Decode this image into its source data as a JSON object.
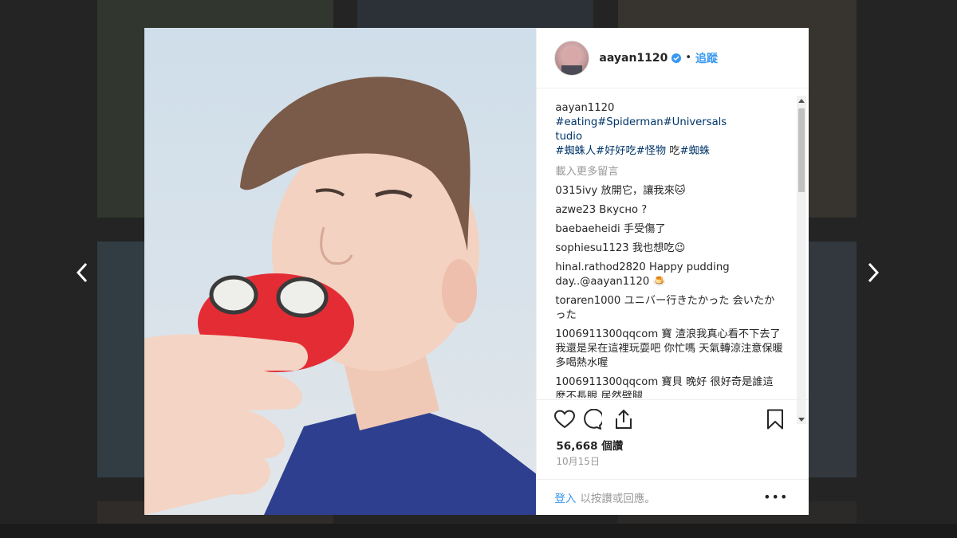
{
  "post": {
    "username": "aayan1120",
    "follow_label": "追蹤",
    "dot": "•",
    "caption_user": "aayan1120",
    "caption_tags_line1": "#eating#Spiderman#Universals",
    "caption_tags_line2": "tudio",
    "caption_tags_line3": "#蜘蛛人#好好吃#怪物",
    "caption_plain": " 吃",
    "caption_tags_line3b": "#蜘蛛",
    "load_more": "載入更多留言",
    "likes": "56,668 個讚",
    "date": "10月15日"
  },
  "comments": [
    {
      "user": "0315ivy",
      "text": "放開它，讓我來🐱"
    },
    {
      "user": "azwe23",
      "text": "Вкусно ?"
    },
    {
      "user": "baebaeheidi",
      "text": "手受傷了"
    },
    {
      "user": "sophiesu1123",
      "text": "我也想吃😉"
    },
    {
      "user": "hinal.rathod2820",
      "text": "Happy pudding day..@aayan1120 🍮"
    },
    {
      "user": "toraren1000",
      "text": "ユニバー行きたかった 会いたかった"
    },
    {
      "user": "1006911300qqcom",
      "text": "寶 渣浪我真心看不下去了 我還是呆在這裡玩耍吧 你忙嗎 天氣轉涼注意保暖 多喝熱水喔"
    },
    {
      "user": "1006911300qqcom",
      "text": "寶貝 晚好 很好奇是誰這麼不長眼 居然劈腿"
    }
  ],
  "footer": {
    "login": "登入",
    "text": "以按讚或回應。",
    "more": "•••"
  },
  "icons": [
    "heart-icon",
    "comment-icon",
    "share-icon",
    "bookmark-icon",
    "chevron-left-icon",
    "chevron-right-icon"
  ],
  "colors": {
    "link": "#3897f0",
    "hashtag": "#003569",
    "muted": "#999999",
    "text": "#262626"
  }
}
